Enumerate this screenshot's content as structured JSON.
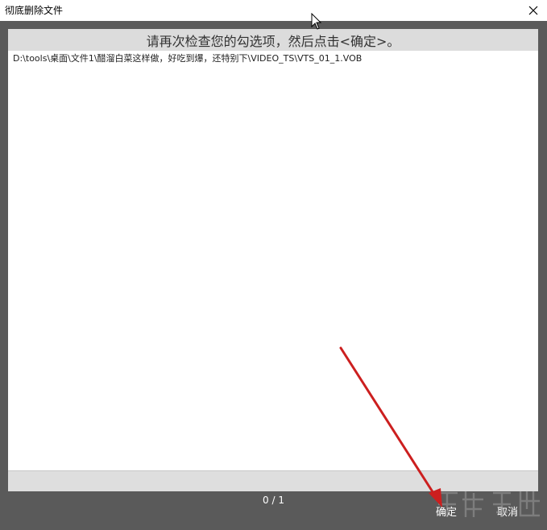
{
  "window": {
    "title": "彻底删除文件"
  },
  "instruction": "请再次检查您的勾选项，然后点击<确定>。",
  "files": [
    "D:\\tools\\桌面\\文件1\\醋溜白菜这样做，好吃到爆，还特别下\\VIDEO_TS\\VTS_01_1.VOB"
  ],
  "pagination": "0 / 1",
  "buttons": {
    "ok": "确定",
    "cancel": "取消"
  },
  "colors": {
    "frame": "#5a5a5a",
    "instruction_bg": "#dcdcdc",
    "arrow": "#cc1f1f"
  },
  "icons": {
    "close": "close-icon",
    "cursor": "mouse-cursor-icon"
  }
}
